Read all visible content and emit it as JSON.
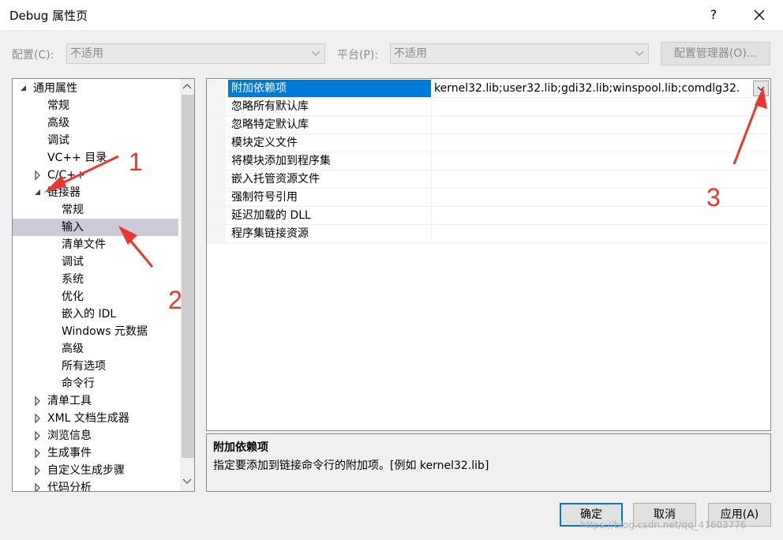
{
  "window": {
    "title": "Debug 属性页",
    "help_label": "?"
  },
  "config_bar": {
    "config_label": "配置(C):",
    "config_value": "不适用",
    "platform_label": "平台(P):",
    "platform_value": "不适用",
    "manager_button": "配置管理器(O)..."
  },
  "tree": {
    "items": [
      {
        "label": "通用属性",
        "expander": "expanded"
      },
      {
        "label": "常规"
      },
      {
        "label": "高级"
      },
      {
        "label": "调试"
      },
      {
        "label": "VC++ 目录"
      },
      {
        "label": "C/C++",
        "expander": "collapsed"
      },
      {
        "label": "链接器",
        "expander": "expanded"
      },
      {
        "label": "常规"
      },
      {
        "label": "输入",
        "selected": true
      },
      {
        "label": "清单文件"
      },
      {
        "label": "调试"
      },
      {
        "label": "系统"
      },
      {
        "label": "优化"
      },
      {
        "label": "嵌入的 IDL"
      },
      {
        "label": "Windows 元数据"
      },
      {
        "label": "高级"
      },
      {
        "label": "所有选项"
      },
      {
        "label": "命令行"
      },
      {
        "label": "清单工具",
        "expander": "collapsed"
      },
      {
        "label": "XML 文档生成器",
        "expander": "collapsed"
      },
      {
        "label": "浏览信息",
        "expander": "collapsed"
      },
      {
        "label": "生成事件",
        "expander": "collapsed"
      },
      {
        "label": "自定义生成步骤",
        "expander": "collapsed"
      },
      {
        "label": "代码分析",
        "expander": "collapsed"
      }
    ]
  },
  "grid": {
    "rows": [
      {
        "name": "附加依赖项",
        "value": "kernel32.lib;user32.lib;gdi32.lib;winspool.lib;comdlg32.",
        "selected": true
      },
      {
        "name": "忽略所有默认库",
        "value": ""
      },
      {
        "name": "忽略特定默认库",
        "value": ""
      },
      {
        "name": "模块定义文件",
        "value": ""
      },
      {
        "name": "将模块添加到程序集",
        "value": ""
      },
      {
        "name": "嵌入托管资源文件",
        "value": ""
      },
      {
        "name": "强制符号引用",
        "value": ""
      },
      {
        "name": "延迟加载的 DLL",
        "value": ""
      },
      {
        "name": "程序集链接资源",
        "value": ""
      }
    ]
  },
  "description": {
    "title": "附加依赖项",
    "text": "指定要添加到链接命令行的附加项。[例如 kernel32.lib]"
  },
  "buttons": {
    "ok": "确定",
    "cancel": "取消",
    "apply": "应用(A)"
  },
  "annotations": [
    "1",
    "2",
    "3"
  ],
  "watermark": "https://blog.csdn.net/qq_41603776",
  "colors": {
    "selection": "#0078d7",
    "tree_selection": "#ccc9d8",
    "annotation": "#e8372f"
  }
}
